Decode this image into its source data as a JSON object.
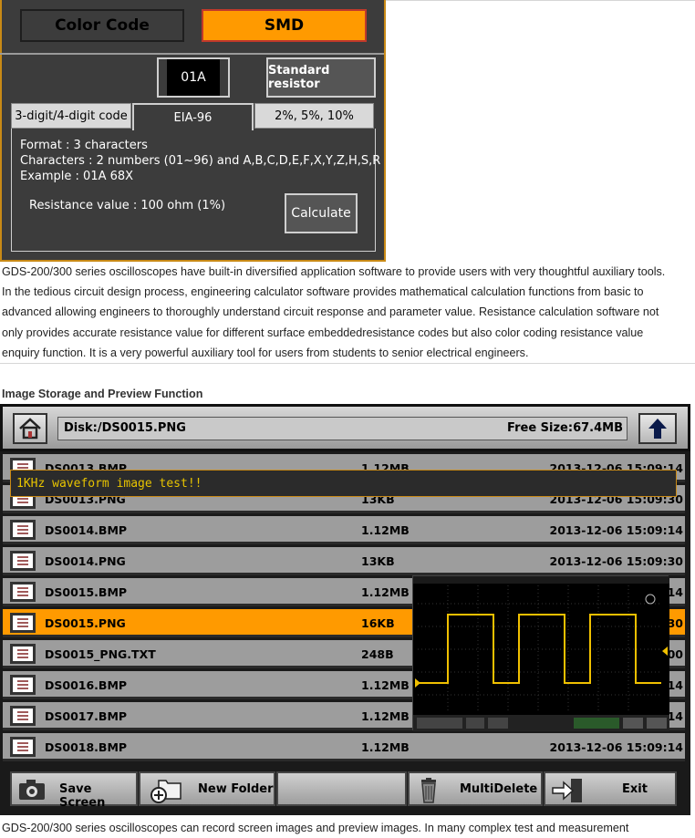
{
  "calculator": {
    "tabs_top": {
      "color_code": "Color Code",
      "smd": "SMD"
    },
    "code_value": "01A",
    "standard_resistor_label": "Standard resistor",
    "tabs": [
      "3-digit/4-digit code",
      "EIA-96",
      "2%, 5%, 10%"
    ],
    "format_line": "Format : 3 characters",
    "characters_line": "Characters : 2 numbers (01~96) and A,B,C,D,E,F,X,Y,Z,H,S,R",
    "example_line": "Example : 01A 68X",
    "resistance_line": "Resistance value : 100 ohm (1%)",
    "calculate_label": "Calculate"
  },
  "article": {
    "para1_lines": [
      "GDS-200/300 series oscilloscopes have built-in diversified application software to provide users with very thoughtful auxiliary tools.",
      "In the tedious circuit design process, engineering calculator software provides mathematical calculation functions from basic to",
      "advanced allowing engineers to thoroughly understand circuit response and parameter value. Resistance calculation software not",
      "only provides accurate resistance value for different surface embeddedresistance codes but also color coding resistance value",
      "enquiry function. It is a very powerful auxiliary tool for users from students to senior electrical engineers."
    ],
    "section_title": "Image Storage and Preview Function",
    "para2": "GDS-200/300 series oscilloscopes can record screen images and preview images. In many complex test and measurement"
  },
  "file_manager": {
    "path": "Disk:/DS0015.PNG",
    "free_size": "Free Size:67.4MB",
    "tooltip": "1KHz waveform image test!!",
    "files": [
      {
        "name": "DS0013.BMP",
        "size": "1.12MB",
        "date": "2013-12-06 15:09:14",
        "selected": false
      },
      {
        "name": "DS0013.PNG",
        "size": "13KB",
        "date": "2013-12-06 15:09:30",
        "selected": false
      },
      {
        "name": "DS0014.BMP",
        "size": "1.12MB",
        "date": "2013-12-06 15:09:14",
        "selected": false
      },
      {
        "name": "DS0014.PNG",
        "size": "13KB",
        "date": "2013-12-06 15:09:30",
        "selected": false
      },
      {
        "name": "DS0015.BMP",
        "size": "1.12MB",
        "date": ":14",
        "selected": false
      },
      {
        "name": "DS0015.PNG",
        "size": "16KB",
        "date": ":30",
        "selected": true
      },
      {
        "name": "DS0015_PNG.TXT",
        "size": "248B",
        "date": ":00",
        "selected": false
      },
      {
        "name": "DS0016.BMP",
        "size": "1.12MB",
        "date": ":14",
        "selected": false
      },
      {
        "name": "DS0017.BMP",
        "size": "1.12MB",
        "date": ":14",
        "selected": false
      },
      {
        "name": "DS0018.BMP",
        "size": "1.12MB",
        "date": "2013-12-06 15:09:14",
        "selected": false
      }
    ],
    "buttons": {
      "save_screen": "Save Screen",
      "new_folder": "New Folder",
      "multi_delete": "MultiDelete",
      "exit": "Exit"
    },
    "icons": [
      "home-icon",
      "up-arrow-icon",
      "file-icon",
      "camera-icon",
      "folder-add-icon",
      "trash-icon",
      "exit-icon"
    ],
    "colors": {
      "accent": "#ff9a00",
      "row": "#9d9d9d",
      "waveform": "#f0c000"
    }
  }
}
